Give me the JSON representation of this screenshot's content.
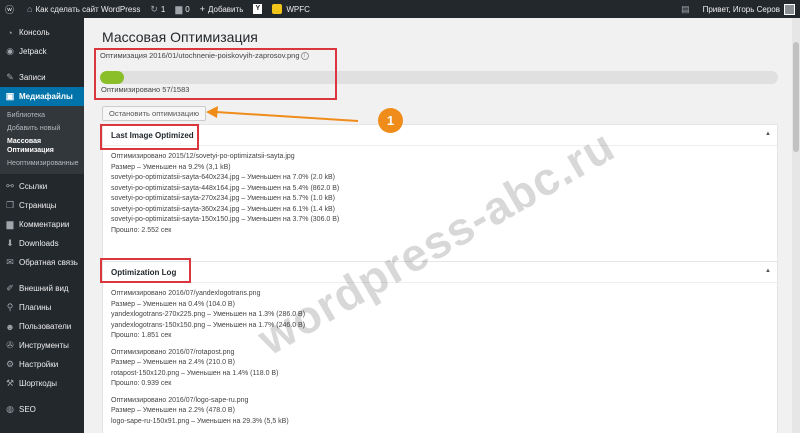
{
  "adminbar": {
    "site_name": "Как сделать сайт WordPress",
    "updates_count": "1",
    "comments_count": "0",
    "add_label": "Добавить",
    "wpfc_label": "WPFC",
    "greeting": "Привет, Игорь Серов"
  },
  "sidebar": {
    "items": [
      {
        "label": "Консоль",
        "icon": "dashboard-icon"
      },
      {
        "label": "Jetpack",
        "icon": "jetpack-icon"
      },
      {
        "label": "Записи",
        "icon": "pin-icon"
      },
      {
        "label": "Медиафайлы",
        "icon": "media-icon"
      },
      {
        "label": "Ссылки",
        "icon": "link-icon"
      },
      {
        "label": "Страницы",
        "icon": "pages-icon"
      },
      {
        "label": "Комментарии",
        "icon": "comments-icon"
      },
      {
        "label": "Downloads",
        "icon": "download-icon"
      },
      {
        "label": "Обратная связь",
        "icon": "feedback-icon"
      },
      {
        "label": "Внешний вид",
        "icon": "appearance-icon"
      },
      {
        "label": "Плагины",
        "icon": "plugins-icon"
      },
      {
        "label": "Пользователи",
        "icon": "users-icon"
      },
      {
        "label": "Инструменты",
        "icon": "tools-icon"
      },
      {
        "label": "Настройки",
        "icon": "settings-icon"
      },
      {
        "label": "Шорткоды",
        "icon": "shortcodes-icon"
      },
      {
        "label": "SEO",
        "icon": "seo-icon"
      }
    ],
    "submenu": [
      "Библиотека",
      "Добавить новый",
      "Массовая Оптимизация",
      "Неоптимизированные"
    ]
  },
  "page": {
    "title": "Массовая Оптимизация",
    "progress_prefix": "Оптимизация",
    "progress_file": "2016/01/utochnenie-poiskovyih-zaprosov.png",
    "progress_fraction": 0.036,
    "progress_count": "Оптимизировано 57/1583",
    "stop_button": "Остановить оптимизацию"
  },
  "last_image": {
    "title": "Last Image Optimized",
    "lines": [
      "Оптимизировано 2015/12/sovetyi-po-optimizatsii-sayta.jpg",
      "Размер – Уменьшен на 9.2% (3,1 kB)",
      "sovetyi-po-optimizatsii-sayta-640x234.jpg – Уменьшен на 7.0% (2.0 kB)",
      "sovetyi-po-optimizatsii-sayta-448x164.jpg – Уменьшен на 5.4% (862.0 B)",
      "sovetyi-po-optimizatsii-sayta-270x234.jpg – Уменьшен на 5.7% (1.0 kB)",
      "sovetyi-po-optimizatsii-sayta-360x234.jpg – Уменьшен на 6.1% (1.4 kB)",
      "sovetyi-po-optimizatsii-sayta-150x150.jpg – Уменьшен на 3.7% (306.0 B)",
      "Прошло: 2.552 сек"
    ]
  },
  "log": {
    "title": "Optimization Log",
    "entries": [
      {
        "lines": [
          "Оптимизировано 2016/07/yandexlogotrans.png",
          "Размер – Уменьшен на 0.4% (104.0 B)",
          "yandexlogotrans-270x225.png – Уменьшен на 1.3% (286.0 B)",
          "yandexlogotrans-150x150.png – Уменьшен на 1.7% (246.0 B)",
          "Прошло: 1.851 сек"
        ]
      },
      {
        "lines": [
          "Оптимизировано 2016/07/rotapost.png",
          "Размер – Уменьшен на 2.4% (210.0 B)",
          "rotapost-150x120.png – Уменьшен на 1.4% (118.0 B)",
          "Прошло: 0.939 сек"
        ]
      },
      {
        "lines": [
          "Оптимизировано 2016/07/logo-sape-ru.png",
          "Размер – Уменьшен на 2.2% (478.0 B)",
          "logo-sape-ru-150x91.png – Уменьшен на 29.3% (5,5 kB)"
        ]
      }
    ]
  },
  "annotation": {
    "badge": "1",
    "color": "#d9363e",
    "arrow_color": "#f08c1a"
  },
  "watermark": "wordpress-abc.ru",
  "colors": {
    "accent": "#0073aa",
    "adminbar_bg": "#23282d",
    "progress_fill": "#8bbf2a"
  }
}
